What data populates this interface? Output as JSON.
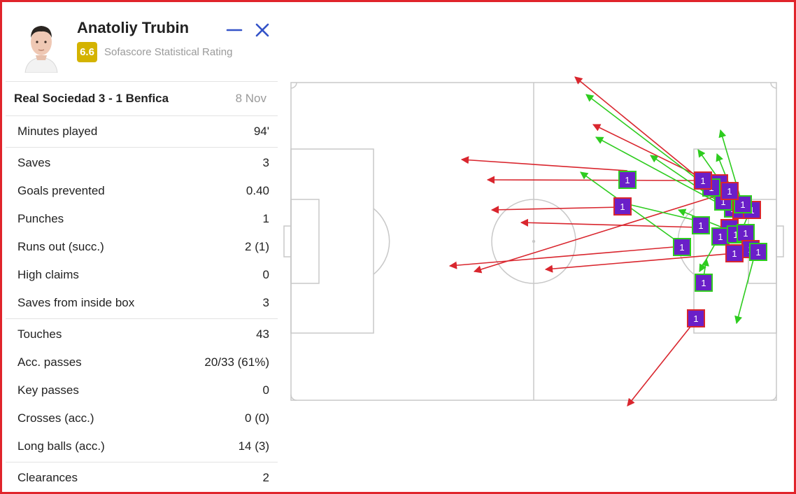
{
  "player": {
    "name": "Anatoliy Trubin",
    "rating": "6.6",
    "rating_label": "Sofascore Statistical Rating",
    "rating_color": "#d4b300"
  },
  "window": {
    "minimize_icon": "minimize-icon",
    "close_icon": "close-icon",
    "accent": "#3453c8"
  },
  "match": {
    "title": "Real Sociedad 3 - 1 Benfica",
    "date": "8 Nov"
  },
  "stat_groups": [
    [
      {
        "label": "Minutes played",
        "value": "94'"
      }
    ],
    [
      {
        "label": "Saves",
        "value": "3"
      },
      {
        "label": "Goals prevented",
        "value": "0.40"
      },
      {
        "label": "Punches",
        "value": "1"
      },
      {
        "label": "Runs out (succ.)",
        "value": "2 (1)"
      },
      {
        "label": "High claims",
        "value": "0"
      },
      {
        "label": "Saves from inside box",
        "value": "3"
      }
    ],
    [
      {
        "label": "Touches",
        "value": "43"
      },
      {
        "label": "Acc. passes",
        "value": "20/33 (61%)"
      },
      {
        "label": "Key passes",
        "value": "0"
      },
      {
        "label": "Crosses (acc.)",
        "value": "0 (0)"
      },
      {
        "label": "Long balls (acc.)",
        "value": "14 (3)"
      }
    ],
    [
      {
        "label": "Clearances",
        "value": "2"
      }
    ]
  ],
  "pass_map": {
    "marker_label": "1",
    "colors": {
      "accurate": "#2ecc1f",
      "inaccurate": "#d9262e",
      "marker_fill": "#6a1fc8",
      "pitch_line": "#c8c8c8"
    }
  }
}
